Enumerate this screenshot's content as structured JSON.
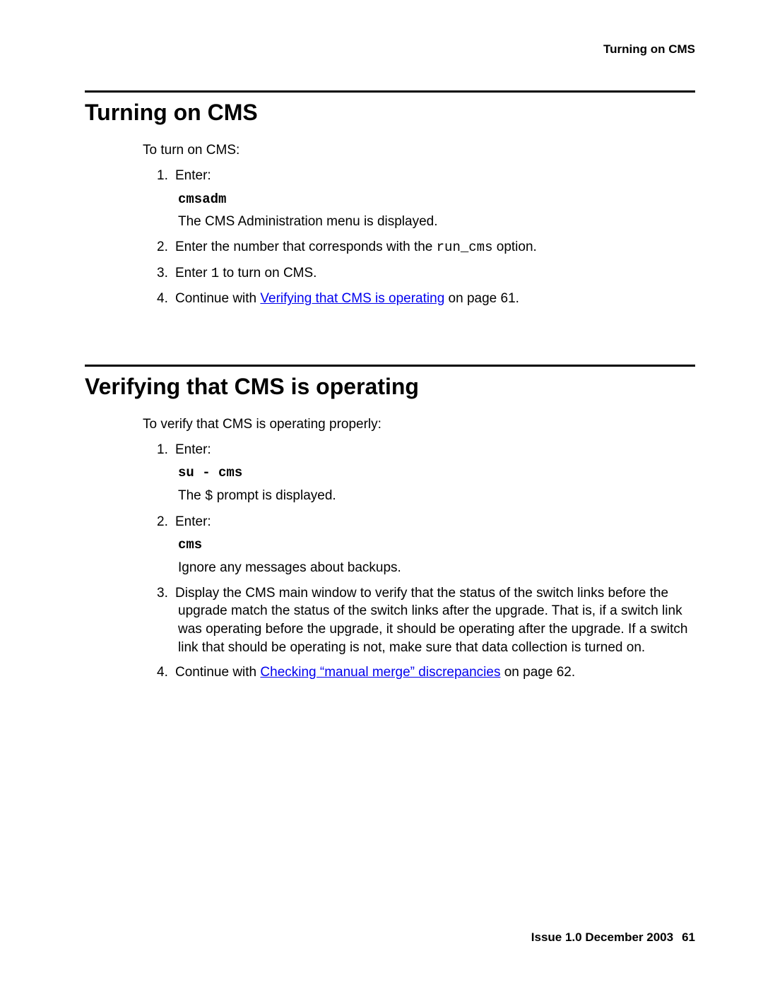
{
  "running_head": "Turning on CMS",
  "section1": {
    "heading": "Turning on CMS",
    "intro": "To turn on CMS:",
    "steps": {
      "s1": {
        "num": "1.",
        "text": "Enter:",
        "cmd": "cmsadm",
        "result": "The CMS Administration menu is displayed."
      },
      "s2": {
        "num": "2.",
        "before": "Enter the number that corresponds with the ",
        "code": "run_cms",
        "after": " option."
      },
      "s3": {
        "num": "3.",
        "before": "Enter ",
        "code": "1",
        "after": " to turn on CMS."
      },
      "s4": {
        "num": "4.",
        "before": "Continue with ",
        "link": "Verifying that CMS is operating",
        "after": " on page 61."
      }
    }
  },
  "section2": {
    "heading": "Verifying that CMS is operating",
    "intro": "To verify that CMS is operating properly:",
    "steps": {
      "s1": {
        "num": "1.",
        "text": "Enter:",
        "cmd": "su - cms",
        "res_before": "The ",
        "res_code": "$",
        "res_after": " prompt is displayed."
      },
      "s2": {
        "num": "2.",
        "text": "Enter:",
        "cmd": "cms",
        "result": "Ignore any messages about backups."
      },
      "s3": {
        "num": "3.",
        "text": "Display the CMS main window to verify that the status of the switch links before the upgrade match the status of the switch links after the upgrade. That is, if a switch link was operating before the upgrade, it should be operating after the upgrade. If a switch link that should be operating is not, make sure that data collection is turned on."
      },
      "s4": {
        "num": "4.",
        "before": "Continue with ",
        "link": "Checking “manual merge” discrepancies",
        "after": " on page 62."
      }
    }
  },
  "footer": {
    "issue": "Issue 1.0   December 2003",
    "page": "61"
  }
}
